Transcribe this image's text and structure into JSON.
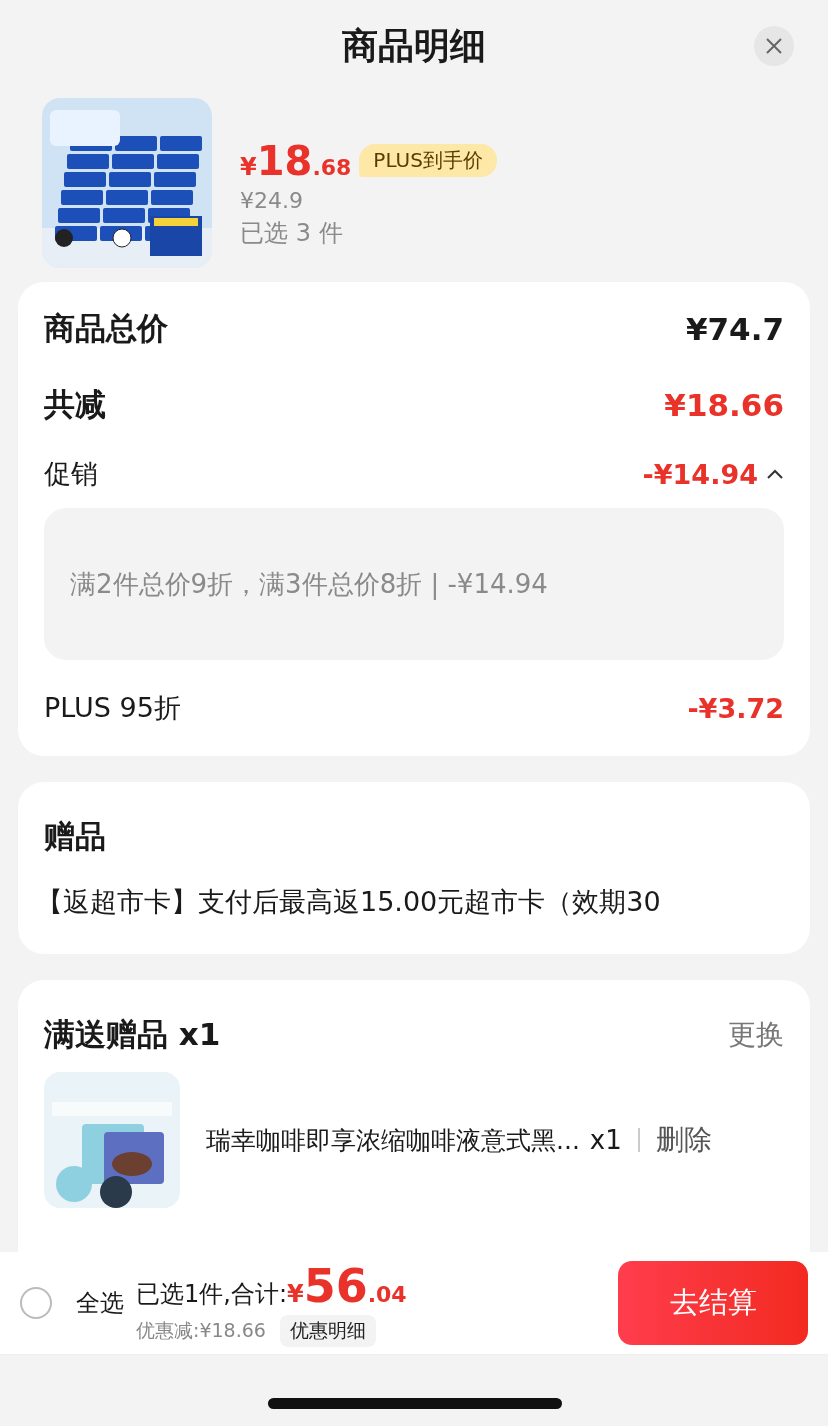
{
  "header": {
    "title": "商品明细"
  },
  "product": {
    "price": {
      "currency": "¥",
      "integer": "18",
      "decimal": ".68"
    },
    "price_tag": "PLUS到手价",
    "original_price": "¥24.9",
    "selected_count": "已选 3 件"
  },
  "price_summary": {
    "total_label": "商品总价",
    "total_value": "¥74.7",
    "discount_label": "共减",
    "discount_value": "¥18.66",
    "promotion": {
      "label": "促销",
      "value": "-¥14.94",
      "expanded": true,
      "detail": "满2件总价9折，满3件总价8折 | -¥14.94"
    },
    "plus_label": "PLUS 95折",
    "plus_value": "-¥3.72"
  },
  "gift": {
    "title": "赠品",
    "text": "【返超市卡】支付后最高返15.00元超市卡（效期30"
  },
  "free_gift": {
    "title": "满送赠品 x1",
    "action": "更换",
    "item": {
      "name": "瑞幸咖啡即享浓缩咖啡液意式黑...",
      "qty": "x1",
      "remove": "删除"
    }
  },
  "footer": {
    "select_all": {
      "label": "全选",
      "checked": false
    },
    "summary": "已选1件,合计:",
    "total": {
      "currency": "¥",
      "integer": "56",
      "decimal": ".04"
    },
    "saved": "优惠减:¥18.66",
    "details_button": "优惠明细",
    "checkout_button": "去结算"
  }
}
